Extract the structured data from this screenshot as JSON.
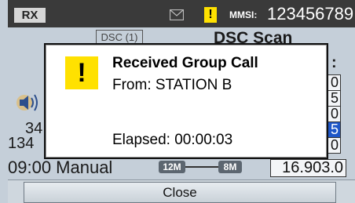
{
  "status_bar": {
    "rx_label": "RX",
    "mail_icon": "envelope-icon",
    "warning_icon": "warning-icon",
    "warning_glyph": "!",
    "mmsi_label": "MMSI:",
    "mmsi_value": "123456789"
  },
  "background": {
    "dsc_tag": "DSC (1)",
    "title": "DSC Scan",
    "speaker_icon": "speaker-icon",
    "colon": ":",
    "row_a": "34",
    "row_b": "134",
    "bottom_left": "09:00 Manual",
    "band_left": "12M",
    "band_right": "8M",
    "column_values": [
      "0",
      "5",
      "0",
      "5",
      "0"
    ],
    "bottom_right": "16.903.0"
  },
  "dialog": {
    "icon": "warning-icon",
    "icon_glyph": "!",
    "title": "Received Group Call",
    "from": "From: STATION B",
    "elapsed": "Elapsed: 00:00:03"
  },
  "footer": {
    "close_label": "Close"
  },
  "colors": {
    "screen_bg": "#c5cfd9",
    "status_bar_bg": "#3a3a3a",
    "warning_yellow": "#ffe100",
    "highlight_blue": "#1f57c8"
  }
}
